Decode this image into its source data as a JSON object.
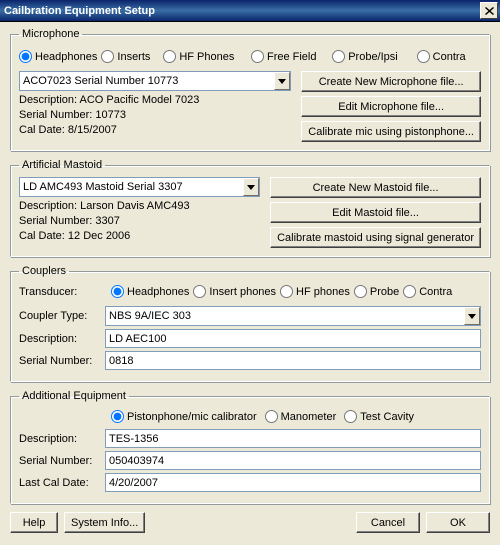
{
  "title": "Cailbration Equipment Setup",
  "microphone": {
    "legend": "Microphone",
    "radios": [
      "Headphones",
      "Inserts",
      "HF Phones",
      "Free Field",
      "Probe/Ipsi",
      "Contra"
    ],
    "selected": "ACO7023 Serial Number 10773",
    "desc_label": "Description: ACO Pacific Model 7023",
    "serial_label": "Serial Number: 10773",
    "cal_label": "Cal Date: 8/15/2007",
    "btn_create": "Create New Microphone file...",
    "btn_edit": "Edit Microphone file...",
    "btn_cal": "Calibrate mic using pistonphone..."
  },
  "mastoid": {
    "legend": "Artificial Mastoid",
    "selected": "LD AMC493 Mastoid Serial 3307",
    "desc_label": "Description: Larson Davis AMC493",
    "serial_label": "Serial Number: 3307",
    "cal_label": "Cal Date: 12 Dec 2006",
    "btn_create": "Create New Mastoid file...",
    "btn_edit": "Edit Mastoid file...",
    "btn_cal": "Calibrate mastoid using signal generator"
  },
  "couplers": {
    "legend": "Couplers",
    "trans_label": "Transducer:",
    "trans_radios": [
      "Headphones",
      "Insert phones",
      "HF phones",
      "Probe",
      "Contra"
    ],
    "type_label": "Coupler Type:",
    "type_value": "NBS 9A/IEC 303",
    "desc_label": "Description:",
    "desc_value": "LD AEC100",
    "serial_label": "Serial Number:",
    "serial_value": "0818"
  },
  "additional": {
    "legend": "Additional Equipment",
    "radios": [
      "Pistonphone/mic calibrator",
      "Manometer",
      "Test Cavity"
    ],
    "desc_label": "Description:",
    "desc_value": "TES-1356",
    "serial_label": "Serial Number:",
    "serial_value": "050403974",
    "cal_label": "Last Cal Date:",
    "cal_value": "4/20/2007"
  },
  "buttons": {
    "help": "Help",
    "system": "System Info...",
    "cancel": "Cancel",
    "ok": "OK"
  }
}
